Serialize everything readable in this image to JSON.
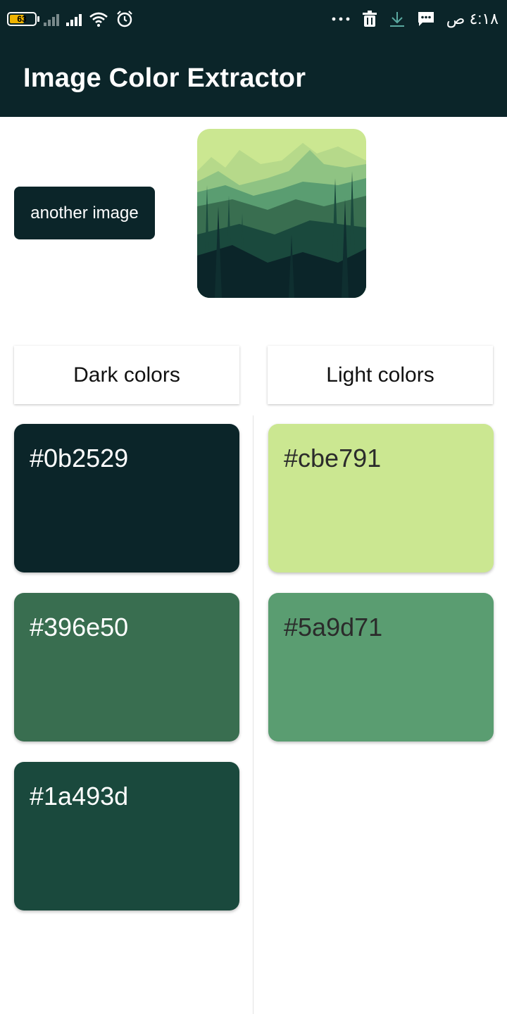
{
  "status_bar": {
    "battery": "63",
    "time": "٤:١٨ ص",
    "icons": [
      "battery-icon",
      "signal-icon",
      "signal-icon",
      "wifi-icon",
      "alarm-icon",
      "more-dots-icon",
      "trash-icon",
      "download-icon",
      "message-icon"
    ]
  },
  "app_bar": {
    "title": "Image Color Extractor"
  },
  "actions": {
    "another_image_label": "another image"
  },
  "preview": {
    "icon": "forest-image"
  },
  "dark": {
    "header": "Dark colors",
    "swatches": [
      {
        "hex": "#0b2529",
        "color": "#0b2529",
        "text_color": "#ffffff"
      },
      {
        "hex": "#396e50",
        "color": "#396e50",
        "text_color": "#ffffff"
      },
      {
        "hex": "#1a493d",
        "color": "#1a493d",
        "text_color": "#ffffff"
      }
    ]
  },
  "light": {
    "header": "Light colors",
    "swatches": [
      {
        "hex": "#cbe791",
        "color": "#cbe791",
        "text_color": "#2b2b2b"
      },
      {
        "hex": "#5a9d71",
        "color": "#5a9d71",
        "text_color": "#2b2b2b"
      }
    ]
  }
}
